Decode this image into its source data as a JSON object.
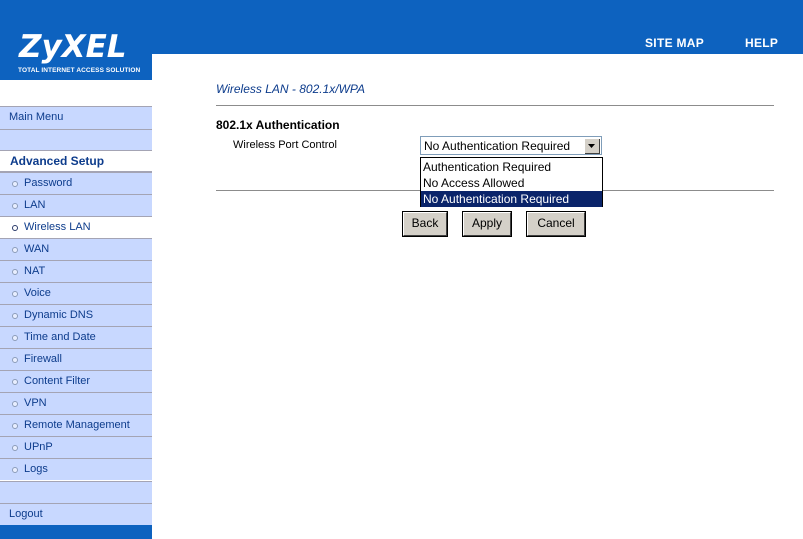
{
  "brand": {
    "logo": "ZyXEL",
    "tagline": "TOTAL INTERNET ACCESS SOLUTION",
    "color": "#0d62bf"
  },
  "header": {
    "site_map_label": "SITE MAP",
    "help_label": "HELP"
  },
  "sidebar": {
    "main_menu_label": "Main Menu",
    "advanced_header": "Advanced Setup",
    "items": [
      {
        "label": "Password",
        "active": false
      },
      {
        "label": "LAN",
        "active": false
      },
      {
        "label": "Wireless LAN",
        "active": true
      },
      {
        "label": "WAN",
        "active": false
      },
      {
        "label": "NAT",
        "active": false
      },
      {
        "label": "Voice",
        "active": false
      },
      {
        "label": "Dynamic DNS",
        "active": false
      },
      {
        "label": "Time and Date",
        "active": false
      },
      {
        "label": "Firewall",
        "active": false
      },
      {
        "label": "Content Filter",
        "active": false
      },
      {
        "label": "VPN",
        "active": false
      },
      {
        "label": "Remote Management",
        "active": false
      },
      {
        "label": "UPnP",
        "active": false
      },
      {
        "label": "Logs",
        "active": false
      }
    ],
    "logout_label": "Logout"
  },
  "main": {
    "page_title": "Wireless LAN - 802.1x/WPA",
    "section_title": "802.1x Authentication",
    "port_control": {
      "label": "Wireless Port Control",
      "selected": "No Authentication Required",
      "options": [
        "Authentication Required",
        "No Access Allowed",
        "No Authentication Required"
      ],
      "highlighted_index": 2
    },
    "buttons": {
      "back": "Back",
      "apply": "Apply",
      "cancel": "Cancel"
    }
  }
}
